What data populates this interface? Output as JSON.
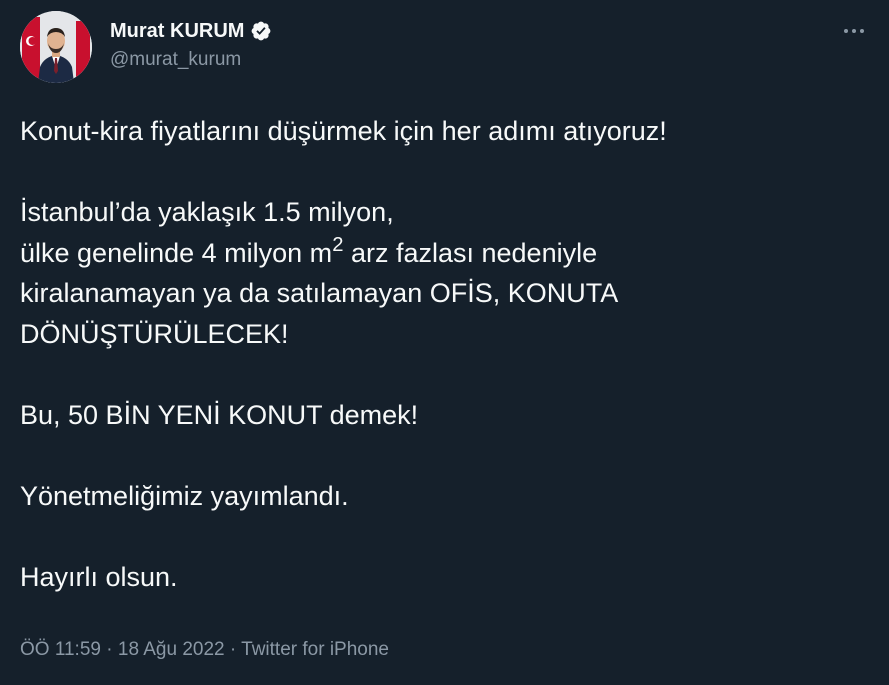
{
  "author": {
    "display_name": "Murat KURUM",
    "handle": "@murat_kurum",
    "verified_icon": "verified-badge-icon",
    "avatar_icon": "profile-photo"
  },
  "menu_icon": "more-dots-icon",
  "tweet": {
    "para1": "Konut-kira fiyatlarını düşürmek için her adımı atıyoruz!",
    "para2_line1": "İstanbul’da yaklaşık 1.5 milyon,",
    "para2_line2_pre": "ülke genelinde 4 milyon m",
    "para2_line2_sup": "2",
    "para2_line2_post": " arz fazlası nedeniyle",
    "para2_line3": "kiralanamayan ya da satılamayan OFİS, KONUTA",
    "para2_line4": "DÖNÜŞTÜRÜLECEK!",
    "para3": "Bu, 50 BİN YENİ KONUT demek!",
    "para4": "Yönetmeliğimiz yayımlandı.",
    "para5": "Hayırlı olsun."
  },
  "meta": {
    "time": "ÖÖ 11:59",
    "separator1": " · ",
    "date": "18 Ağu 2022",
    "separator2": " · ",
    "source": "Twitter for iPhone"
  },
  "colors": {
    "background": "#15202b",
    "text": "#f7f9f9",
    "secondary": "#8b98a5",
    "verified": "#f7f9f9"
  }
}
